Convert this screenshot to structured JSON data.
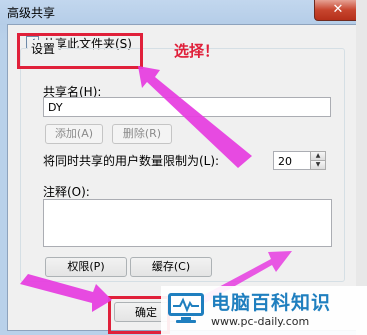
{
  "window": {
    "title": "高级共享",
    "close_label": "✕"
  },
  "share_checkbox": {
    "label": "共享此文件夹(S)",
    "checked": true,
    "check_glyph": "✓"
  },
  "settings": {
    "group_title": "设置",
    "share_name_label": "共享名(H):",
    "share_name_value": "DY",
    "add_button": "添加(A)",
    "remove_button": "删除(R)",
    "limit_label": "将同时共享的用户数量限制为(L):",
    "limit_value": "20",
    "comment_label": "注释(O):",
    "permissions_button": "权限(P)",
    "cache_button": "缓存(C)"
  },
  "footer": {
    "ok_button_visible": "确定"
  },
  "annotation": {
    "text": "选择！",
    "color": "#e0203a"
  },
  "watermark": {
    "brand": "电脑百科知识",
    "url": "www.pc-daily.com",
    "brand_color": "#1f7fbf"
  },
  "icons": {
    "spinner_up": "▲",
    "spinner_down": "▼",
    "logo": "monitor-pulse-icon"
  }
}
